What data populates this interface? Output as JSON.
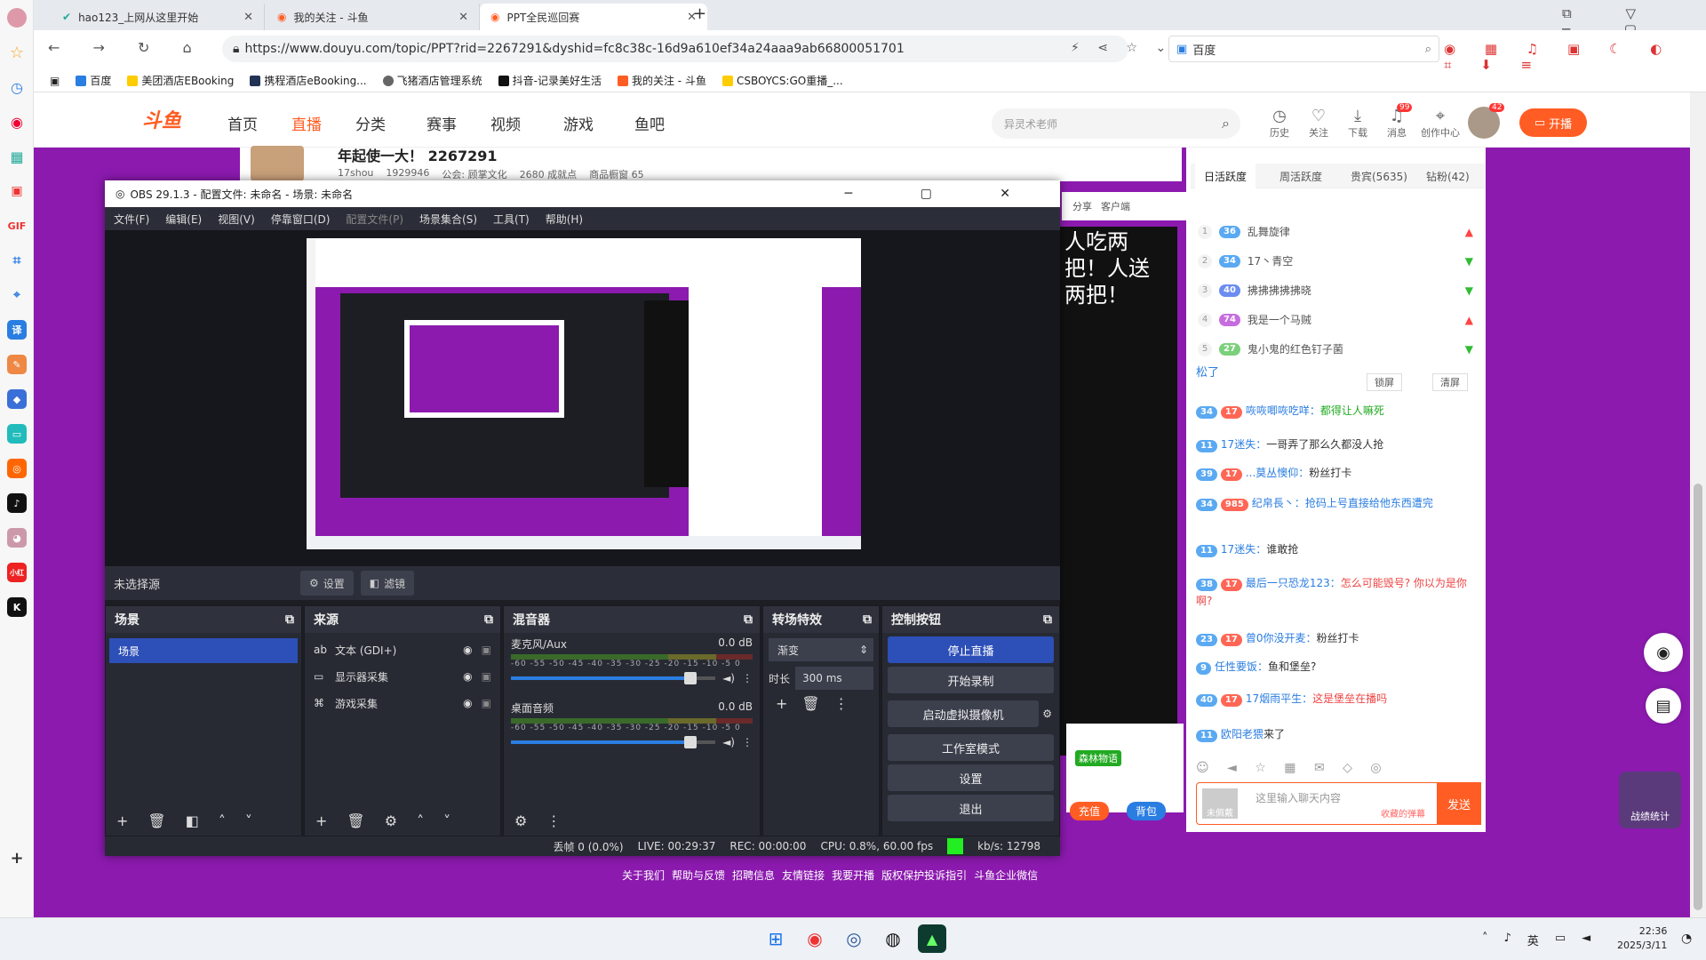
{
  "browser": {
    "tabs": [
      {
        "title": "hao123_上网从这里开始"
      },
      {
        "title": "我的关注 - 斗鱼"
      },
      {
        "title": "PPT全民巡回赛"
      }
    ],
    "url": "https://www.douyu.com/topic/PPT?rid=2267291&dyshid=fc8c38c-16d9a610ef34a24aaa9ab66800051701",
    "search_engine": "百度",
    "bookmarks": [
      "百度",
      "美团酒店EBooking",
      "携程酒店eBooking...",
      "飞猪酒店管理系统",
      "抖音-记录美好生活",
      "我的关注 - 斗鱼",
      "CSBOYCS:GO重播_..."
    ]
  },
  "douyu": {
    "logo": "斗鱼",
    "nav": [
      "首页",
      "直播",
      "分类",
      "赛事",
      "视频",
      "游戏",
      "鱼吧"
    ],
    "search_placeholder": "异灵术老师",
    "header_icons": [
      {
        "label": "历史",
        "icon": "clock-icon"
      },
      {
        "label": "关注",
        "icon": "heart-icon"
      },
      {
        "label": "下载",
        "icon": "download-icon"
      },
      {
        "label": "消息",
        "icon": "bell-icon",
        "badge": "99"
      },
      {
        "label": "创作中心",
        "icon": "pin-icon"
      }
    ],
    "avatar_badge": "42",
    "open_label": "开播",
    "room_title": "年起使一大！ 2267291",
    "room_stats": [
      "17shou",
      "1929946",
      "公会: 顾掌文化",
      "2680 成就点",
      "商品橱窗 65"
    ],
    "share": "分享",
    "client": "客户端",
    "stream_overlay": "人吃两把！人送两把！",
    "rank_tabs": [
      "日活跃度",
      "周活跃度",
      "贵宾(5635)",
      "钻粉(42)"
    ],
    "ranks": [
      {
        "n": "1",
        "lv": "36",
        "name": "乱舞旋律",
        "trend": "up"
      },
      {
        "n": "2",
        "lv": "34",
        "name": "17丶青空",
        "trend": "down"
      },
      {
        "n": "3",
        "lv": "40",
        "name": "拂拂拂拂拂晓",
        "trend": "down"
      },
      {
        "n": "4",
        "lv": "74",
        "name": "我是一个马贼",
        "trend": "up"
      },
      {
        "n": "5",
        "lv": "27",
        "name": "鬼小鬼的红色钉子菌",
        "trend": "down"
      }
    ],
    "chat_top": "松了",
    "lock_label": "锁屏",
    "clear_label": "清屏",
    "chat": [
      {
        "lv": "34",
        "fan": "17",
        "user": "咴咴唧咴吃咩：",
        "msg": "都得让人嘛死"
      },
      {
        "lv": "11",
        "fan": "",
        "user": "17迷失：",
        "msg": "一哥弄了那么久都没人抢"
      },
      {
        "lv": "39",
        "fan": "17",
        "user": "...莫丛懊仰：",
        "msg": "粉丝打卡"
      },
      {
        "lv": "34",
        "fan": "985",
        "user": "纪帛長丶：",
        "msg": "抢码上号直接给他东西遭完"
      },
      {
        "lv": "11",
        "fan": "",
        "user": "17迷失：",
        "msg": "谁敢抢"
      },
      {
        "lv": "38",
        "fan": "17",
        "user": "最后一只恐龙123：",
        "msg": "怎么可能毁号? 你以为是你啊?"
      },
      {
        "lv": "23",
        "fan": "17",
        "user": "曾0你没开麦：",
        "msg": "粉丝打卡"
      },
      {
        "lv": "9",
        "fan": "",
        "user": "任性要饭：",
        "msg": "鱼和堡垒?"
      },
      {
        "lv": "40",
        "fan": "17",
        "user": "17烟雨平生：",
        "msg": "这是堡垒在播吗"
      },
      {
        "lv": "11",
        "fan": "",
        "user": "欧阳老猥",
        "msg": "来了"
      }
    ],
    "chat_input_placeholder": "这里输入聊天内容",
    "send_label": "发送",
    "unlogged": "未佩戴",
    "recv_label": "收藏的弹幕",
    "recharge": "充值",
    "backpack": "背包",
    "forest": "森林物语",
    "footer_links": [
      "关于我们",
      "帮助与反馈",
      "招聘信息",
      "友情链接",
      "我要开播",
      "版权保护投诉指引",
      "斗鱼企业微信"
    ],
    "battle_label": "战绩统计"
  },
  "obs": {
    "title": "OBS 29.1.3 - 配置文件: 未命名 - 场景: 未命名",
    "menu": [
      "文件(F)",
      "编辑(E)",
      "视图(V)",
      "停靠窗口(D)",
      "配置文件(P)",
      "场景集合(S)",
      "工具(T)",
      "帮助(H)"
    ],
    "no_source": "未选择源",
    "settings_btn": "设置",
    "filter_btn": "滤镜",
    "scenes_title": "场景",
    "scene_item": "场景",
    "sources_title": "来源",
    "sources": [
      {
        "name": "文本 (GDI+)",
        "icon": "text-icon"
      },
      {
        "name": "显示器采集",
        "icon": "monitor-icon"
      },
      {
        "name": "游戏采集",
        "icon": "gamepad-icon"
      }
    ],
    "mixer_title": "混音器",
    "mixer": [
      {
        "name": "麦克风/Aux",
        "db": "0.0 dB",
        "level": 0.88
      },
      {
        "name": "桌面音频",
        "db": "0.0 dB",
        "level": 0.88
      }
    ],
    "meter_ticks": "-60 -55 -50 -45 -40 -35 -30 -25 -20 -15 -10 -5 0",
    "transition_title": "转场特效",
    "transition_value": "渐变",
    "duration_label": "时长",
    "duration_value": "300 ms",
    "controls_title": "控制按钮",
    "controls": [
      "停止直播",
      "开始录制",
      "启动虚拟摄像机",
      "工作室模式",
      "设置",
      "退出"
    ],
    "status": {
      "dropped": "丢帧 0 (0.0%)",
      "live": "LIVE: 00:29:37",
      "rec": "REC: 00:00:00",
      "cpu": "CPU: 0.8%, 60.00 fps",
      "kbs": "kb/s: 12798"
    }
  },
  "taskbar": {
    "ime": "英",
    "time": "22:36",
    "date": "2025/3/11"
  }
}
